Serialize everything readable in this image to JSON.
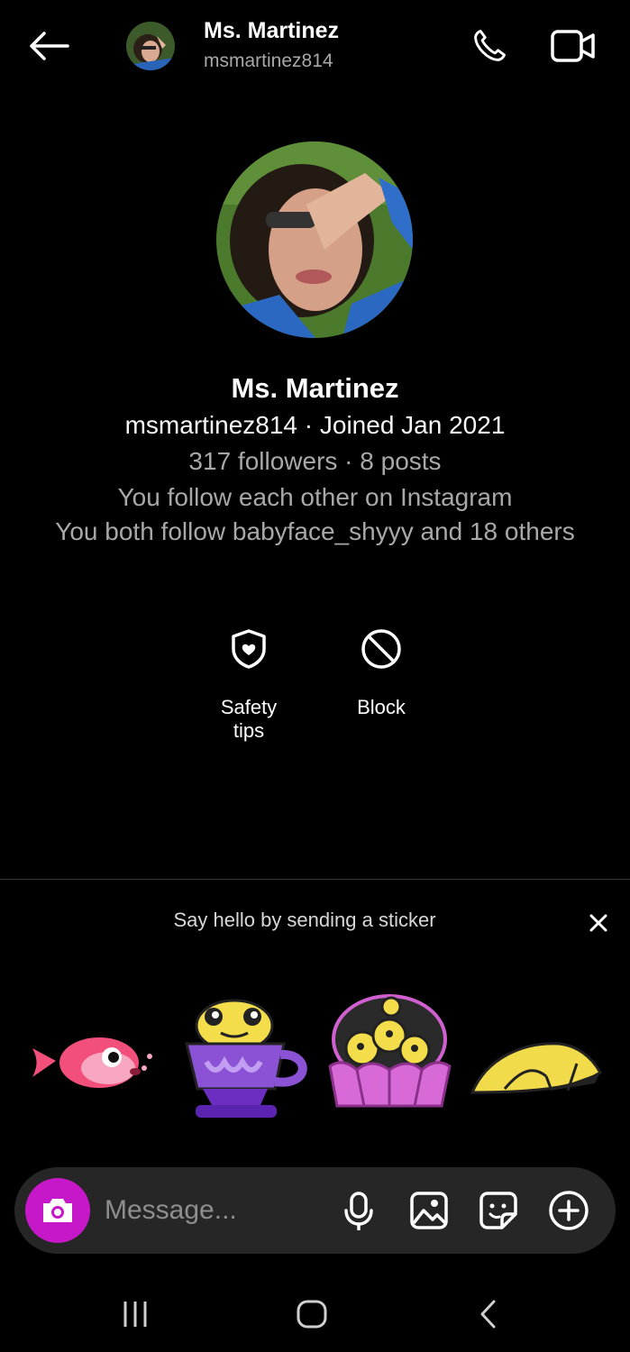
{
  "header": {
    "name": "Ms. Martinez",
    "username": "msmartinez814"
  },
  "profile": {
    "name": "Ms. Martinez",
    "meta": "msmartinez814 · Joined Jan 2021",
    "stats": "317 followers · 8 posts",
    "mutual_follow": "You follow each other on Instagram",
    "mutual_line": "You both follow babyface_shyyy and 18 others"
  },
  "actions": {
    "safety_label_1": "Safety",
    "safety_label_2": "tips",
    "block_label": "Block"
  },
  "sticker_prompt": "Say hello by sending a sticker",
  "composer": {
    "placeholder": "Message..."
  },
  "colors": {
    "background": "#000000",
    "composer_bg": "#262626",
    "camera_accent": "#c617c9",
    "secondary_text": "#a8a8a8"
  },
  "icons": [
    "back-arrow-icon",
    "phone-icon",
    "video-camera-icon",
    "shield-heart-icon",
    "block-icon",
    "close-icon",
    "camera-icon",
    "microphone-icon",
    "gallery-icon",
    "sticker-icon",
    "plus-circle-icon",
    "recent-apps-icon",
    "home-icon",
    "nav-back-icon"
  ]
}
